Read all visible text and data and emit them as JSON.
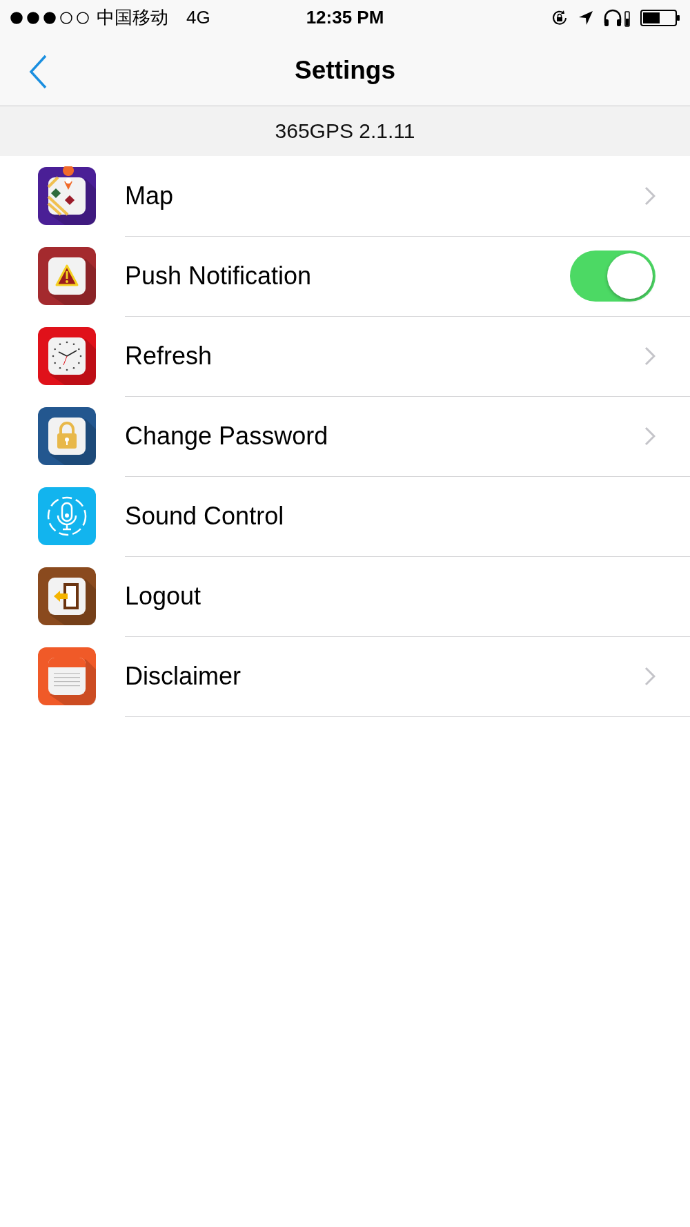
{
  "status_bar": {
    "carrier": "中国移动",
    "network": "4G",
    "time": "12:35 PM"
  },
  "nav": {
    "title": "Settings"
  },
  "version": "365GPS 2.1.11",
  "items": [
    {
      "label": "Map",
      "kind": "chevron"
    },
    {
      "label": "Push Notification",
      "kind": "toggle",
      "on": true
    },
    {
      "label": "Refresh",
      "kind": "chevron"
    },
    {
      "label": "Change Password",
      "kind": "chevron"
    },
    {
      "label": "Sound Control",
      "kind": "plain"
    },
    {
      "label": "Logout",
      "kind": "plain"
    },
    {
      "label": "Disclaimer",
      "kind": "chevron"
    }
  ]
}
